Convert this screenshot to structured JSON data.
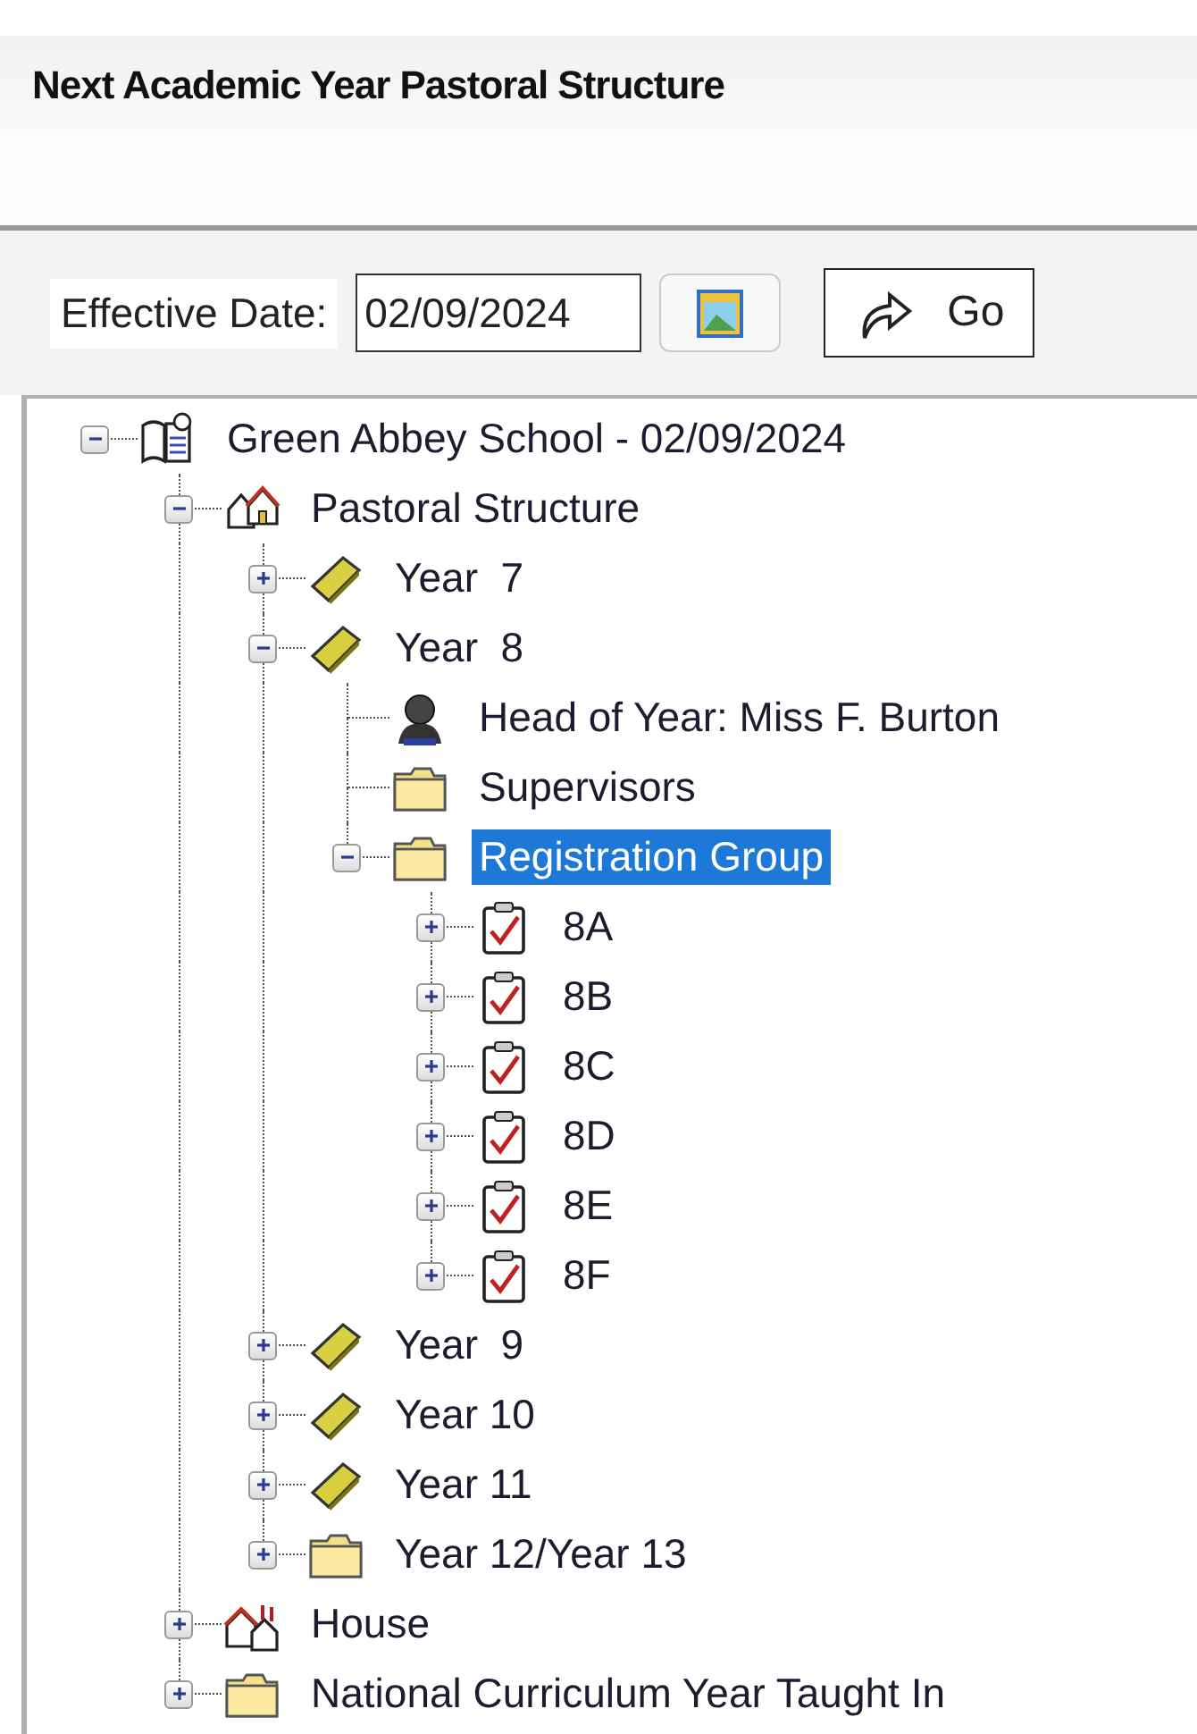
{
  "title": "Next Academic Year Pastoral Structure",
  "toolbar": {
    "date_label": "Effective Date:",
    "date_value": "02/09/2024",
    "go_label": "Go"
  },
  "tree": [
    {
      "label": "Green Abbey School - 02/09/2024",
      "kind": "school",
      "expanded": true,
      "selected": false,
      "children": [
        {
          "label": "Pastoral Structure",
          "kind": "structure",
          "expanded": true,
          "selected": false,
          "children": [
            {
              "label": "Year  7",
              "kind": "year",
              "expanded": false,
              "selected": false
            },
            {
              "label": "Year  8",
              "kind": "year",
              "expanded": true,
              "selected": false,
              "children": [
                {
                  "label": "Head of Year: Miss F. Burton",
                  "kind": "person",
                  "selected": false
                },
                {
                  "label": "Supervisors",
                  "kind": "folder",
                  "selected": false
                },
                {
                  "label": "Registration Group",
                  "kind": "folder",
                  "expanded": true,
                  "selected": true,
                  "children": [
                    {
                      "label": "8A",
                      "kind": "register",
                      "expanded": false,
                      "selected": false
                    },
                    {
                      "label": "8B",
                      "kind": "register",
                      "expanded": false,
                      "selected": false
                    },
                    {
                      "label": "8C",
                      "kind": "register",
                      "expanded": false,
                      "selected": false
                    },
                    {
                      "label": "8D",
                      "kind": "register",
                      "expanded": false,
                      "selected": false
                    },
                    {
                      "label": "8E",
                      "kind": "register",
                      "expanded": false,
                      "selected": false
                    },
                    {
                      "label": "8F",
                      "kind": "register",
                      "expanded": false,
                      "selected": false
                    }
                  ]
                }
              ]
            },
            {
              "label": "Year  9",
              "kind": "year",
              "expanded": false,
              "selected": false
            },
            {
              "label": "Year 10",
              "kind": "year",
              "expanded": false,
              "selected": false
            },
            {
              "label": "Year 11",
              "kind": "year",
              "expanded": false,
              "selected": false
            },
            {
              "label": "Year 12/Year 13",
              "kind": "folder",
              "expanded": false,
              "selected": false
            }
          ]
        },
        {
          "label": "House",
          "kind": "houses",
          "expanded": false,
          "selected": false
        },
        {
          "label": "National Curriculum Year Taught In",
          "kind": "folder",
          "expanded": false,
          "selected": false
        }
      ]
    }
  ]
}
